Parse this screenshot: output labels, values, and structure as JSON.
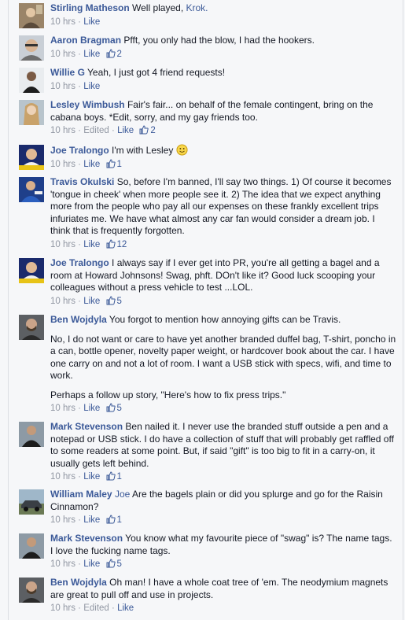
{
  "meta_sep": "·",
  "comments": [
    {
      "author": "Stirling Matheson",
      "text": "Well played, ",
      "link": "Krok.",
      "tail": "",
      "time": "10 hrs",
      "edited": "",
      "action": "Like",
      "likes": ""
    },
    {
      "author": "Aaron Bragman",
      "text": "Pfft, you only had the blow, I had the hookers.",
      "time": "10 hrs",
      "edited": "",
      "action": "Like",
      "likes": "2"
    },
    {
      "author": "Willie G",
      "text": "Yeah, I just got 4 friend requests!",
      "time": "10 hrs",
      "edited": "",
      "action": "Like",
      "likes": ""
    },
    {
      "author": "Lesley Wimbush",
      "text": "Fair's fair... on behalf of the female contingent, bring on the cabana boys. *Edit, sorry, and my gay friends too.",
      "time": "10 hrs",
      "edited": "Edited",
      "action": "Like",
      "likes": "2"
    },
    {
      "author": "Joe Tralongo",
      "text": "I'm with Lesley",
      "emoji": "smiley",
      "time": "10 hrs",
      "edited": "",
      "action": "Like",
      "likes": "1"
    },
    {
      "author": "Travis Okulski",
      "text": "So, before I'm banned, I'll say two things. 1) Of course it becomes 'tongue in cheek' when more people see it. 2) The idea that we expect anything more from the people who pay all our expenses on these frankly excellent trips infuriates me. We have what almost any car fan would consider a dream job. I think that is frequently forgotten.",
      "time": "10 hrs",
      "edited": "",
      "action": "Like",
      "likes": "12"
    },
    {
      "author": "Joe Tralongo",
      "text": "I always say if I ever get into PR, you're all getting a bagel and a room at Howard Johnsons! Swag, phft. DOn't like it? Good luck scooping your colleagues without a press vehicle to test ...LOL.",
      "time": "10 hrs",
      "edited": "",
      "action": "Like",
      "likes": "5"
    },
    {
      "author": "Ben Wojdyla",
      "text": "You forgot to mention how annoying gifts can be Travis.",
      "para2": "No, I do not want or care to have yet another branded duffel bag, T-shirt, poncho in a can, bottle opener, novelty paper weight, or hardcover book about the car. I have one carry on and not a lot of room. I want a USB stick with specs, wifi, and time to work.",
      "para3": "Perhaps a follow up story, \"Here's how to fix press trips.\"",
      "time": "10 hrs",
      "edited": "",
      "action": "Like",
      "likes": "5"
    },
    {
      "author": "Mark Stevenson",
      "text": "Ben nailed it. I never use the branded stuff outside a pen and a notepad or USB stick. I do have a collection of stuff that will probably get raffled off to some readers at some point. But, if said \"gift\" is too big to fit in a carry-on, it usually gets left behind.",
      "time": "10 hrs",
      "edited": "",
      "action": "Like",
      "likes": "1"
    },
    {
      "author": "William Maley",
      "mention": "Joe",
      "text": "Are the bagels plain or did you splurge and go for the Raisin Cinnamon?",
      "time": "10 hrs",
      "edited": "",
      "action": "Like",
      "likes": "1"
    },
    {
      "author": "Mark Stevenson",
      "text": "You know what my favourite piece of \"swag\" is? The name tags. I love the fucking name tags.",
      "time": "10 hrs",
      "edited": "",
      "action": "Like",
      "likes": "5"
    },
    {
      "author": "Ben Wojdyla",
      "text": "Oh man! I have a whole coat tree of 'em. The neodymium magnets are great to pull off and use in projects.",
      "time": "10 hrs",
      "edited": "Edited",
      "action": "Like",
      "likes": ""
    }
  ],
  "avatar_icons": [
    "person-avatar-icon"
  ],
  "colors": {
    "link": "#3b5998",
    "meta": "#9197a3",
    "text": "#141823",
    "bg": "#f6f7f9"
  }
}
